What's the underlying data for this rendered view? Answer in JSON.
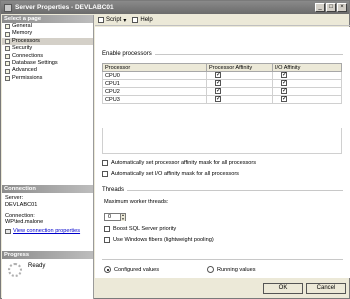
{
  "window": {
    "title": "Server Properties - DEVLABC01",
    "controls": [
      "_",
      "□",
      "×"
    ]
  },
  "left_panel": {
    "select_page_header": "Select a page",
    "pages": [
      {
        "label": "General"
      },
      {
        "label": "Memory"
      },
      {
        "label": "Processors",
        "selected": true
      },
      {
        "label": "Security"
      },
      {
        "label": "Connections"
      },
      {
        "label": "Database Settings"
      },
      {
        "label": "Advanced"
      },
      {
        "label": "Permissions"
      }
    ],
    "connection_header": "Connection",
    "server_label": "Server:",
    "server_value": "DEVLABC01",
    "connection_label": "Connection:",
    "connection_value": "WP\\ted.malone",
    "view_link": "View connection properties",
    "progress_header": "Progress",
    "progress_status": "Ready"
  },
  "toolbar": {
    "script_label": "Script",
    "help_label": "Help"
  },
  "processors": {
    "group_label": "Enable processors",
    "columns": [
      "Processor",
      "Processor Affinity",
      "I/O Affinity"
    ],
    "rows": [
      {
        "name": "CPU0",
        "affinity": true,
        "io": true
      },
      {
        "name": "CPU1",
        "affinity": true,
        "io": true
      },
      {
        "name": "CPU2",
        "affinity": true,
        "io": true
      },
      {
        "name": "CPU3",
        "affinity": true,
        "io": true
      }
    ],
    "auto_affinity": "Automatically set processor affinity mask for all processors",
    "auto_io": "Automatically set I/O affinity mask for all processors"
  },
  "threads": {
    "group_label": "Threads",
    "max_worker_label": "Maximum worker threads:",
    "max_worker_value": "0",
    "boost_label": "Boost SQL Server priority",
    "fibers_label": "Use Windows fibers (lightweight pooling)"
  },
  "values_mode": {
    "configured": "Configured values",
    "running": "Running values",
    "selected": "configured"
  },
  "buttons": {
    "ok": "OK",
    "cancel": "Cancel"
  },
  "colors": {
    "title_bar": "#6b6b6b",
    "link": "#0000cc",
    "panel_bg": "#ece9d8"
  }
}
